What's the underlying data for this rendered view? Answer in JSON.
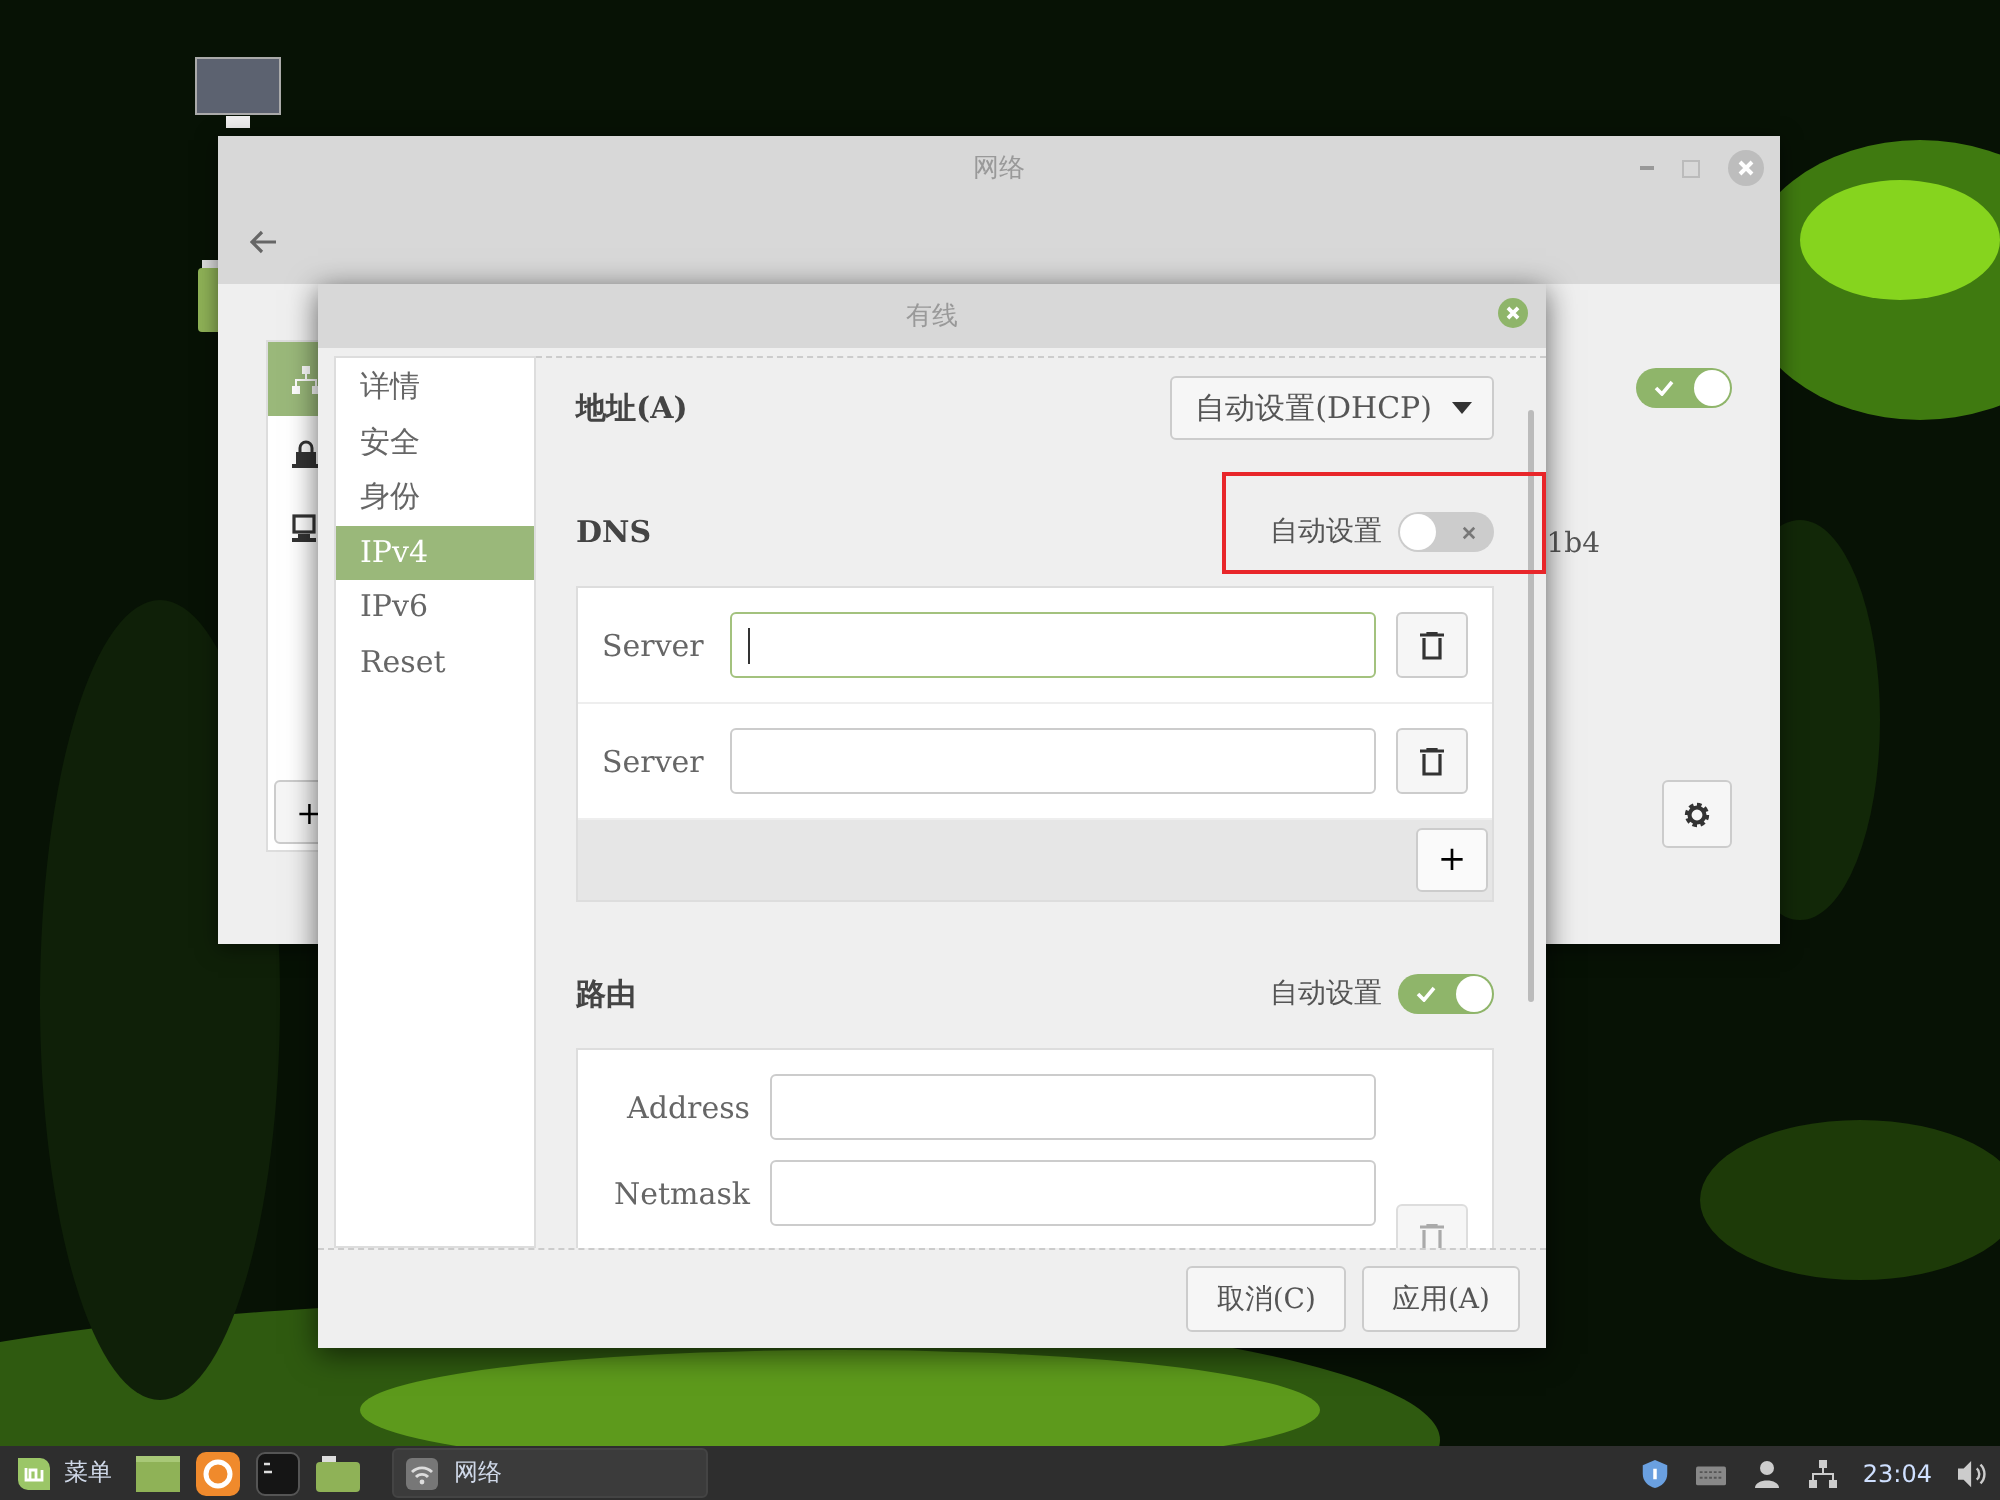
{
  "desktop": {
    "icons": [
      {
        "kind": "monitor"
      },
      {
        "kind": "folder"
      }
    ]
  },
  "network_window": {
    "title": "网络",
    "devices": [
      {
        "kind": "wired",
        "selected": true
      },
      {
        "kind": "lock",
        "selected": false
      },
      {
        "kind": "computer",
        "selected": false
      }
    ],
    "add_button": "+",
    "wired_on": true,
    "detail_text": "1b4"
  },
  "dialog": {
    "title": "有线",
    "sidebar": [
      {
        "label": "详情",
        "selected": false
      },
      {
        "label": "安全",
        "selected": false
      },
      {
        "label": "身份",
        "selected": false
      },
      {
        "label": "IPv4",
        "selected": true
      },
      {
        "label": "IPv6",
        "selected": false
      },
      {
        "label": "Reset",
        "selected": false
      }
    ],
    "address": {
      "label": "地址(A)",
      "method": "自动设置(DHCP)"
    },
    "dns": {
      "label": "DNS",
      "auto_label": "自动设置",
      "auto": false,
      "servers": [
        {
          "label": "Server",
          "focused": true
        },
        {
          "label": "Server",
          "focused": false
        }
      ],
      "add_button": "+"
    },
    "routes": {
      "label": "路由",
      "auto_label": "自动设置",
      "auto": true,
      "fields": [
        {
          "label": "Address"
        },
        {
          "label": "Netmask"
        }
      ]
    },
    "buttons": [
      "取消(C)",
      "应用(A)"
    ]
  },
  "taskbar": {
    "menu_label": "菜单",
    "launchers": [
      {
        "kind": "window"
      },
      {
        "kind": "browser"
      },
      {
        "kind": "terminal"
      },
      {
        "kind": "folder"
      }
    ],
    "windows": [
      {
        "label": "网络"
      }
    ],
    "clock": "23:04"
  }
}
